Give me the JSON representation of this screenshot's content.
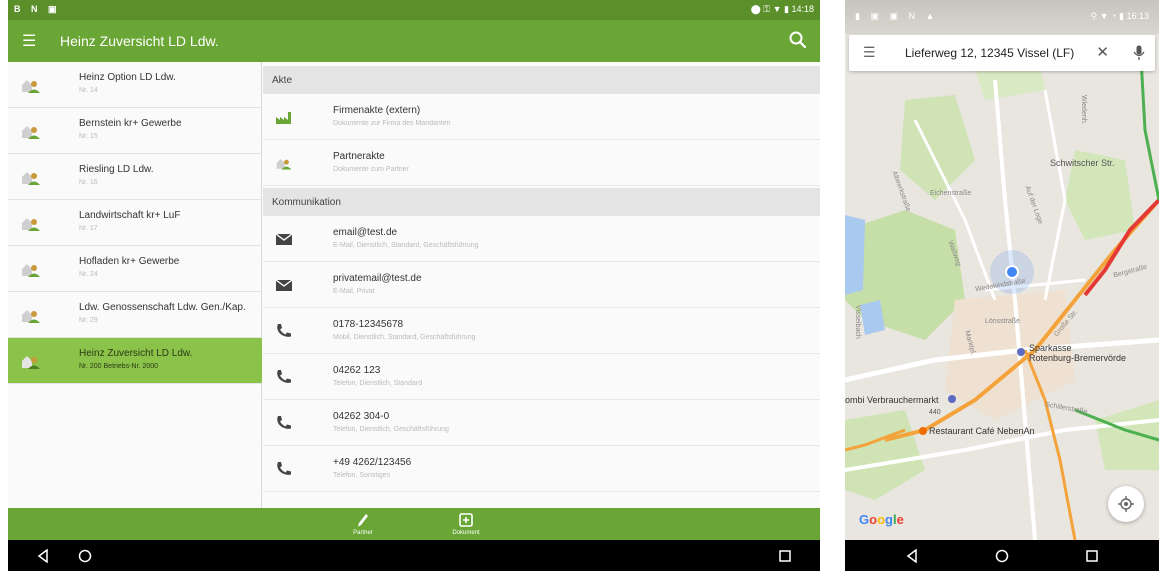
{
  "tablet": {
    "status": {
      "left_icons": "B N ▣",
      "right_text": "⬤ ⚿ ▼ ▮ 14:18"
    },
    "app_title": "Heinz Zuversicht  LD Ldw.",
    "partners": [
      {
        "name": "Heinz Option LD Ldw.",
        "sub": "Nr. 14"
      },
      {
        "name": "Bernstein kr+ Gewerbe",
        "sub": "Nr. 15"
      },
      {
        "name": "Riesling LD Ldw.",
        "sub": "Nr. 16"
      },
      {
        "name": "Landwirtschaft kr+ LuF",
        "sub": "Nr. 17"
      },
      {
        "name": "Hofladen kr+ Gewerbe",
        "sub": "Nr. 24"
      },
      {
        "name": "Ldw. Genossenschaft Ldw. Gen./Kap.",
        "sub": "Nr. 29"
      },
      {
        "name": "Heinz Zuversicht  LD Ldw.",
        "sub": "Nr. 200  Betriebs-Nr. 2000",
        "selected": true
      }
    ],
    "sections": {
      "akte": "Akte",
      "kommunikation": "Kommunikation"
    },
    "akte_rows": [
      {
        "title": "Firmenakte (extern)",
        "sub": "Dokumente zur Firma des Mandanten",
        "icon": "factory-icon"
      },
      {
        "title": "Partnerakte",
        "sub": "Dokumente zum Partner",
        "icon": "partner-icon"
      }
    ],
    "kommunikation_rows": [
      {
        "title": "email@test.de",
        "sub": "E-Mail, Dienstlich, Standard, Geschäftsführung",
        "icon": "mail-icon"
      },
      {
        "title": "privatemail@test.de",
        "sub": "E-Mail, Privat",
        "icon": "mail-icon"
      },
      {
        "title": "0178-12345678",
        "sub": "Mobil, Dienstlich, Standard, Geschäftsführung",
        "icon": "phone-icon"
      },
      {
        "title": "04262 123",
        "sub": "Telefon, Dienstlich, Standard",
        "icon": "phone-icon"
      },
      {
        "title": "04262 304-0",
        "sub": "Telefon, Dienstlich, Geschäftsführung",
        "icon": "phone-icon"
      },
      {
        "title": "+49 4262/123456",
        "sub": "Telefon, Sonstiges",
        "icon": "phone-icon"
      }
    ],
    "bottom_actions": {
      "partner": "Partner",
      "dokument": "Dokument"
    }
  },
  "phone": {
    "status": {
      "left_icons": "▮ ▣ ▣ N ▲",
      "right_text": "⚲ ▼ ◔ ▮ 16:13"
    },
    "search_query": "Lieferweg 12, 12345 Vissel (LF)",
    "map_labels": {
      "schwitscher": "Schwitscher Str.",
      "eichenstr": "Eichenstraße",
      "altwerkstr": "Altwerkstraße",
      "aufderloge": "Auf der Loge",
      "wallweg": "Wallweg",
      "wedekind": "Wedekindstraße",
      "bergstr": "Bergstraße",
      "loens": "Lönsstraße",
      "grosse": "Große Str.",
      "marktpl": "Marktpl.",
      "sparkasse": "Sparkasse\nRotenburg-Bremervörde",
      "verbraucher": "ombi Verbrauchermarkt",
      "schiller": "Schillerstraße",
      "restaurant": "Restaurant Café NebenAn",
      "wiedenh": "Wiedenh.",
      "vissel": "Visselbach",
      "road440": "440"
    },
    "google": "Google"
  }
}
